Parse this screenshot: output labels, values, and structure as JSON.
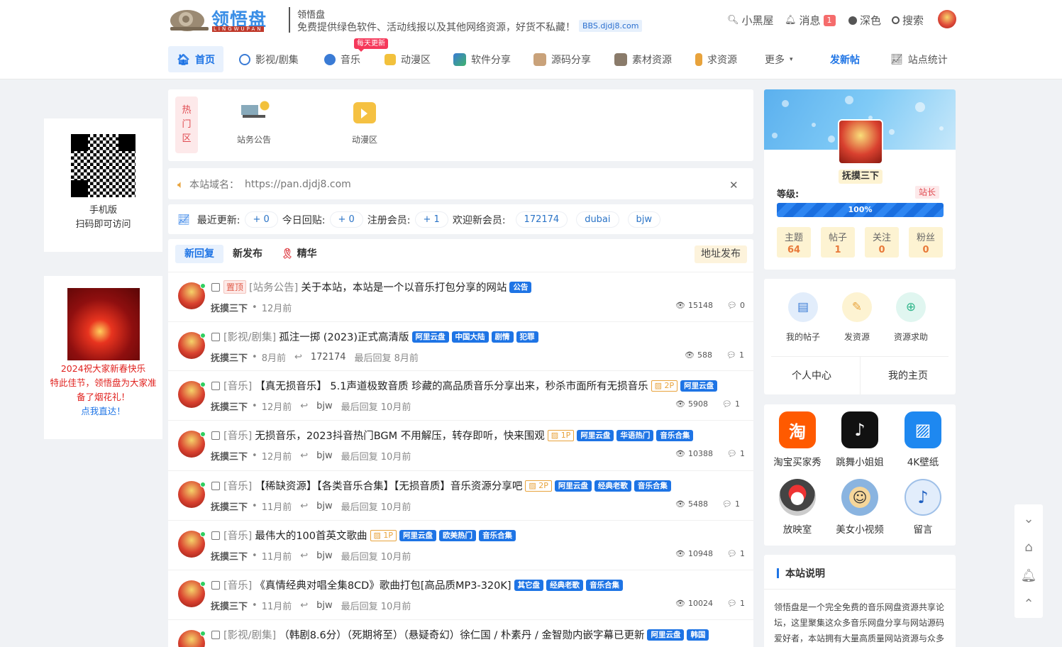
{
  "header": {
    "logo_text": "领悟盘",
    "logo_sub": "LINGWUPAN",
    "site_name": "领悟盘",
    "site_desc": "免费提供绿色软件、活动线报以及其他网络资源，好货不私藏！",
    "domain_badge": "BBS.djdj8.com",
    "links": {
      "xiaoheiwu": "小黑屋",
      "messages": "消息",
      "message_count": "1",
      "dark": "深色",
      "search": "搜索"
    }
  },
  "nav": {
    "items": [
      {
        "label": "首页"
      },
      {
        "label": "影视/剧集"
      },
      {
        "label": "音乐"
      },
      {
        "label": "动漫区"
      },
      {
        "label": "软件分享"
      },
      {
        "label": "源码分享"
      },
      {
        "label": "素材资源"
      },
      {
        "label": "求资源"
      },
      {
        "label": "更多"
      }
    ],
    "badge": "每天更新",
    "post": "发新帖",
    "stats": "站点统计"
  },
  "hot": {
    "tag": [
      "热",
      "门",
      "区"
    ],
    "items": [
      "站务公告",
      "动漫区"
    ]
  },
  "notice": {
    "label": "本站域名：",
    "url": "https://pan.djdj8.com",
    "close": "✕"
  },
  "stats": {
    "latest_label": "最近更新:",
    "latest": "+ 0",
    "today_label": "今日回贴:",
    "today": "+ 0",
    "reg_label": "注册会员:",
    "reg": "+ 1",
    "welcome_label": "欢迎新会员:",
    "members": [
      "172174",
      "dubai",
      "bjw"
    ]
  },
  "tabs": {
    "items": [
      "新回复",
      "新发布",
      "精华"
    ],
    "address": "地址发布"
  },
  "threads": [
    {
      "pin": "置顶",
      "cat": "[站务公告]",
      "title": "关于本站，本站是一个以音乐打包分享的网站",
      "pics": "",
      "tags": [
        "公告"
      ],
      "author": "抚摸三下",
      "time": "12月前",
      "replier": "",
      "last": "",
      "views": "15148",
      "replies": "0"
    },
    {
      "pin": "",
      "cat": "[影视/剧集]",
      "title": "孤注一掷 (2023)正式高清版",
      "pics": "",
      "tags": [
        "阿里云盘",
        "中国大陆",
        "剧情",
        "犯罪"
      ],
      "author": "抚摸三下",
      "time": "8月前",
      "replier": "172174",
      "last": "最后回复 8月前",
      "views": "588",
      "replies": "1"
    },
    {
      "pin": "",
      "cat": "[音乐]",
      "title": "【真无损音乐】 5.1声道极致音质 珍藏的高品质音乐分享出来，秒杀市面所有无损音乐",
      "pics": "2P",
      "tags": [
        "阿里云盘"
      ],
      "author": "抚摸三下",
      "time": "12月前",
      "replier": "bjw",
      "last": "最后回复 10月前",
      "views": "5908",
      "replies": "1"
    },
    {
      "pin": "",
      "cat": "[音乐]",
      "title": "无损音乐，2023抖音热门BGM 不用解压，转存即听，快来围观",
      "pics": "1P",
      "tags": [
        "阿里云盘",
        "华语热门",
        "音乐合集"
      ],
      "author": "抚摸三下",
      "time": "12月前",
      "replier": "bjw",
      "last": "最后回复 10月前",
      "views": "10388",
      "replies": "1"
    },
    {
      "pin": "",
      "cat": "[音乐]",
      "title": "【稀缺资源】【各类音乐合集】【无损音质】音乐资源分享吧",
      "pics": "2P",
      "tags": [
        "阿里云盘",
        "经典老歌",
        "音乐合集"
      ],
      "author": "抚摸三下",
      "time": "11月前",
      "replier": "bjw",
      "last": "最后回复 10月前",
      "views": "5488",
      "replies": "1"
    },
    {
      "pin": "",
      "cat": "[音乐]",
      "title": "最伟大的100首英文歌曲",
      "pics": "1P",
      "tags": [
        "阿里云盘",
        "欧美热门",
        "音乐合集"
      ],
      "author": "抚摸三下",
      "time": "11月前",
      "replier": "bjw",
      "last": "最后回复 10月前",
      "views": "10948",
      "replies": "1"
    },
    {
      "pin": "",
      "cat": "[音乐]",
      "title": "《真情经典对唱全集8CD》歌曲打包[高品质MP3-320K]",
      "pics": "",
      "tags": [
        "其它盘",
        "经典老歌",
        "音乐合集"
      ],
      "author": "抚摸三下",
      "time": "11月前",
      "replier": "bjw",
      "last": "最后回复 10月前",
      "views": "10024",
      "replies": "1"
    },
    {
      "pin": "",
      "cat": "[影视/剧集]",
      "title": "（韩剧8.6分）（死期将至）（悬疑奇幻）徐仁国 / 朴素丹 / 金智勋内嵌字幕已更新",
      "pics": "",
      "tags": [
        "阿里云盘",
        "韩国"
      ],
      "author": "",
      "time": "",
      "replier": "",
      "last": "",
      "views": "",
      "replies": ""
    }
  ],
  "profile": {
    "name": "抚摸三下",
    "level_label": "等级:",
    "level": "站长",
    "progress_text": "100%",
    "progress": 1.0,
    "stats": [
      {
        "label": "主题",
        "value": "64"
      },
      {
        "label": "帖子",
        "value": "1"
      },
      {
        "label": "关注",
        "value": "0"
      },
      {
        "label": "粉丝",
        "value": "0"
      }
    ]
  },
  "quick": {
    "items": [
      "我的帖子",
      "发资源",
      "资源求助"
    ],
    "links": [
      "个人中心",
      "我的主页"
    ]
  },
  "apps": [
    "淘宝买家秀",
    "跳舞小姐姐",
    "4K壁纸",
    "放映室",
    "美女小视频",
    "留言"
  ],
  "info": {
    "title": "本站说明",
    "text": "领悟盘是一个完全免费的音乐网盘资源共享论坛，这里聚集这众多音乐网盘分享与网站源码爱好者，本站拥有大量高质量网站资源与众多"
  },
  "left": {
    "qr_line1": "手机版",
    "qr_line2": "扫码即可访问",
    "promo_line1": "2024祝大家新春快乐",
    "promo_line2": "特此佳节，领悟盘为大家准备了烟花礼！",
    "promo_link": "点我直达！"
  },
  "colors": {
    "accent": "#1e74e5",
    "hot": "#e04b51",
    "online": "#2fcf61"
  }
}
